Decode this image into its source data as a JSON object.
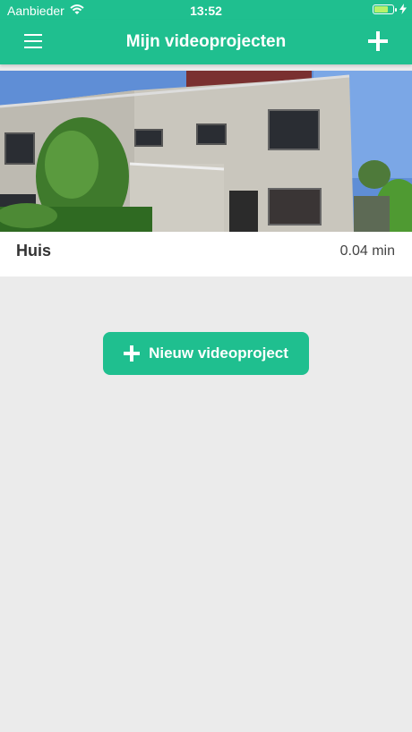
{
  "status_bar": {
    "carrier": "Aanbieder",
    "time": "13:52"
  },
  "nav": {
    "title": "Mijn videoprojecten"
  },
  "projects": [
    {
      "name": "Huis",
      "duration": "0.04 min"
    }
  ],
  "new_project_button": {
    "label": "Nieuw videoproject"
  },
  "colors": {
    "accent": "#1fbf8f",
    "background": "#ebebeb",
    "card": "#ffffff"
  },
  "icons": [
    "wifi-icon",
    "battery-icon",
    "menu-icon",
    "plus-icon"
  ]
}
